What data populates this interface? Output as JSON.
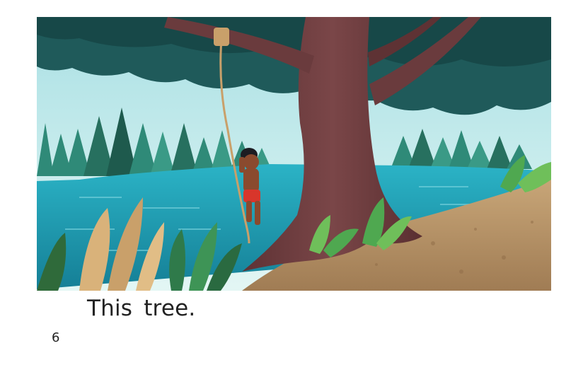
{
  "page": {
    "caption": "This tree.",
    "page_number": "6"
  },
  "illustration": {
    "scene": "lakeside-tree-rope-swing",
    "colors": {
      "sky": "#cfeef0",
      "canopy": "#1f5a5a",
      "lake": "#1f9cb2",
      "trunk": "#6a3b3d",
      "ground": "#b9946a"
    }
  }
}
